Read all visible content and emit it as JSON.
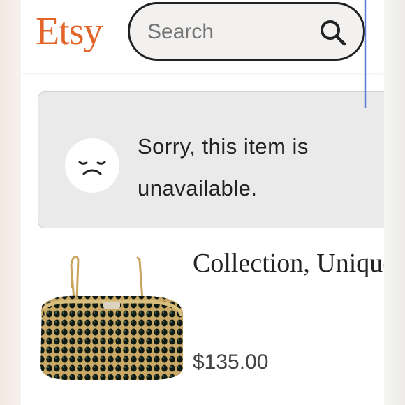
{
  "header": {
    "logo": "Etsy",
    "search": {
      "placeholder": "Search"
    }
  },
  "notice": {
    "message": "Sorry, this item is unavailable.",
    "icon": "sad-face-icon"
  },
  "product": {
    "title": "Collection, Unique Beauty...HANDMADE",
    "price": "$135.00",
    "image": "beaded-handbag"
  },
  "colors": {
    "brand": "#e2652a",
    "notice_bg": "#eaeaea",
    "text": "#222222",
    "search_border": "#222222"
  }
}
